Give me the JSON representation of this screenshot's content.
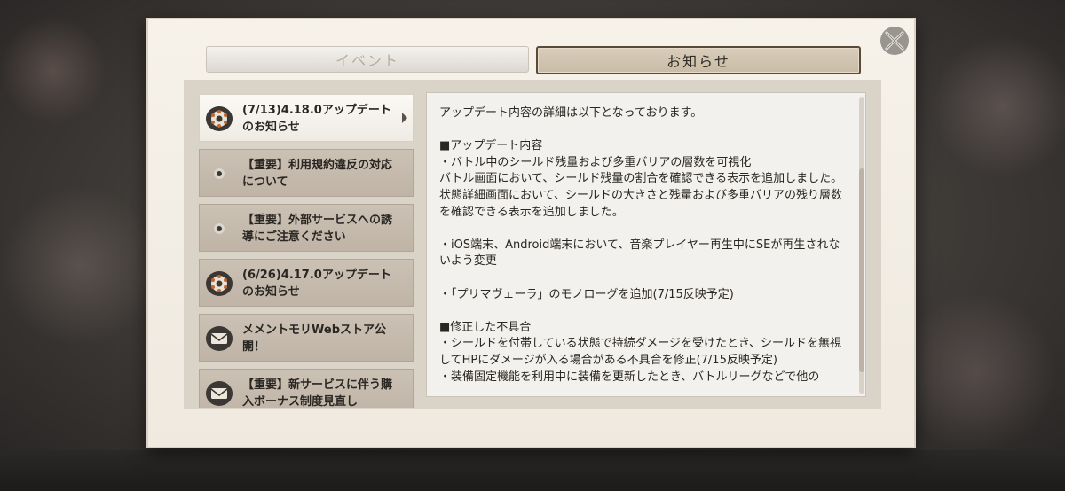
{
  "tabs": [
    {
      "label": "イベント",
      "active": false
    },
    {
      "label": "お知らせ",
      "active": true
    }
  ],
  "news_list": [
    {
      "label": "(7/13)4.18.0アップデートのお知らせ",
      "icon": "gear-icon",
      "selected": true
    },
    {
      "label": "【重要】利用規約違反の対応について",
      "icon": "important-dot-icon",
      "selected": false
    },
    {
      "label": "【重要】外部サービスへの誘導にご注意ください",
      "icon": "important-dot-icon",
      "selected": false
    },
    {
      "label": "(6/26)4.17.0アップデートのお知らせ",
      "icon": "gear-icon",
      "selected": false
    },
    {
      "label": "メメントモリWebストア公開！",
      "icon": "mail-icon",
      "selected": false
    },
    {
      "label": "【重要】新サービスに伴う購入ボーナス制度見直し",
      "icon": "mail-icon",
      "selected": false
    }
  ],
  "detail": {
    "text": "アップデート内容の詳細は以下となっております。\n\n■アップデート内容\n・バトル中のシールド残量および多重バリアの層数を可視化\nバトル画面において、シールド残量の割合を確認できる表示を追加しました。\n状態詳細画面において、シールドの大きさと残量および多重バリアの残り層数を確認できる表示を追加しました。\n\n・iOS端末、Android端末において、音楽プレイヤー再生中にSEが再生されないよう変更\n\n・「プリマヴェーラ」のモノローグを追加(7/15反映予定)\n\n■修正した不具合\n・シールドを付帯している状態で持続ダメージを受けたとき、シールドを無視してHPにダメージが入る場合がある不具合を修正(7/15反映予定)\n・装備固定機能を利用中に装備を更新したとき、バトルリーグなどで他の"
  },
  "colors": {
    "panel_bg": "#f6f2ea",
    "list_item_bg": "#c7bcae",
    "selected_item_bg": "#f9f7f3",
    "active_tab_border": "#5a4a3a"
  }
}
